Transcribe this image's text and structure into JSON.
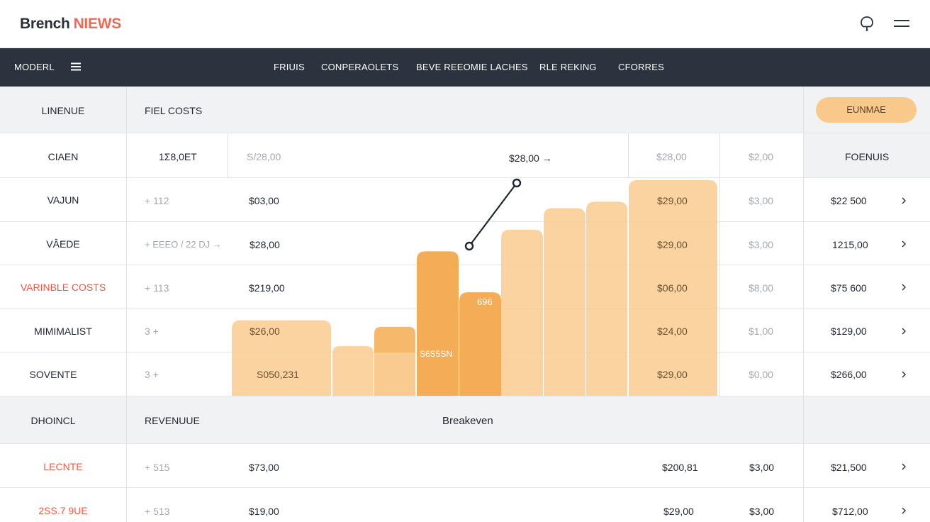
{
  "header": {
    "brand_part1": "Brench",
    "brand_part2": "NIEWS",
    "bell_icon": "bell-icon",
    "menu_icon": "hamburger-menu-icon"
  },
  "nav": {
    "model_label": "MODERL",
    "links": [
      "FRIUIS",
      "CONPERAOLETS",
      "BEVE REEOMIE LACHES",
      "RLE REKING",
      "CFORRES"
    ]
  },
  "table": {
    "header": {
      "col1": "LINENUE",
      "col2": "FIEL COSTS",
      "button_label": "EUNMAE"
    },
    "top_row": {
      "label": "CIAEN",
      "c2": "1Σ8,0ET",
      "c3": "S/28,00",
      "c4": "$28,00 →",
      "c5": "$28,00",
      "c6": "$2,00",
      "c7": "FOENUIS"
    },
    "rows": [
      {
        "label": "VAJUN",
        "c2": "+ 112",
        "c3": "$03,00",
        "c5": "$29,00",
        "c6": "$3,00",
        "c7": "$22 500"
      },
      {
        "label": "VÂEDE",
        "c2": "+ EEEO / 22 DJ →",
        "c3": "$28,00",
        "c5": "$29,00",
        "c6": "$3,00",
        "c7": "1215,00"
      },
      {
        "label": "VARINBLE COSTS",
        "c2": "+ 113",
        "c3": "$219,00",
        "c5": "$06,00",
        "c6": "$8,00",
        "c7": "$75 600"
      },
      {
        "label": "MIMIMALIST",
        "c2": "3 +",
        "c3": "$26,00",
        "c5": "$24,00",
        "c6": "$1,00",
        "c7": "$129,00"
      },
      {
        "label": "SOVENTE",
        "c2": "3 +",
        "c3": "S050,231",
        "c5": "$29,00",
        "c6": "$0,00",
        "c7": "$266,00"
      }
    ],
    "section": {
      "col1": "DHOINCL",
      "col2": "REVENUUE",
      "col3": "Breakeven"
    },
    "bottom_rows": [
      {
        "label": "LECNTE",
        "c2": "+ 515",
        "c3": "$73,00",
        "c5": "$200,81",
        "c6": "$3,00",
        "c7": "$21,500"
      },
      {
        "label": "2SS.7 9UE",
        "c2": "+ 513",
        "c3": "$19,00",
        "c5": "$29,00",
        "c6": "$3,00",
        "c7": "$712,00"
      }
    ]
  },
  "chart_data": {
    "type": "bar",
    "bar_labels": [
      "696",
      "S6S5SN"
    ],
    "bars_relative_height": [
      0.35,
      0.23,
      0.32,
      0.67,
      0.48,
      0.77,
      0.87,
      0.9,
      1.0
    ],
    "line_points_relative": [
      [
        0.0,
        0.0
      ],
      [
        1.0,
        1.0
      ]
    ],
    "colors": {
      "light": "#f9cb91",
      "medium": "#f6b463",
      "dark": "#f4a84d"
    }
  },
  "colors": {
    "nav_bg": "#2c333f",
    "accent_red": "#ec5845",
    "button_bg": "#f8c98b"
  }
}
